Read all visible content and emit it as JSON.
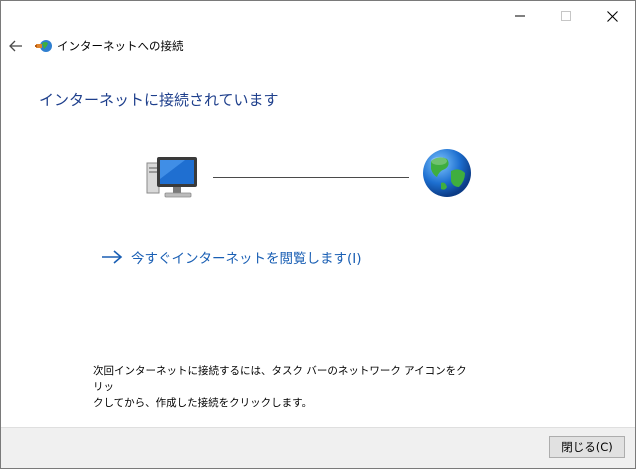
{
  "window": {
    "title": "インターネットへの接続",
    "controls": {
      "minimize_icon": "minimize-icon",
      "maximize_icon": "maximize-icon",
      "close_icon": "close-icon",
      "maximize_disabled": true
    },
    "back_icon": "back-arrow-icon",
    "app_icon": "network-connection-icon"
  },
  "main": {
    "heading": "インターネットに接続されています",
    "diagram": {
      "left_icon": "computer-icon",
      "right_icon": "globe-icon"
    },
    "browse_link": {
      "icon": "arrow-right-icon",
      "label": "今すぐインターネットを閲覧します(I)"
    },
    "instructions": {
      "line1": "次回インターネットに接続するには、タスク バーのネットワーク アイコンをクリッ",
      "line2": "クしてから、作成した接続をクリックします。"
    }
  },
  "footer": {
    "close_button_label": "閉じる(C)"
  },
  "colors": {
    "heading": "#1e3f8c",
    "link": "#1a5fb4",
    "footer_bg": "#f0f0f0"
  }
}
